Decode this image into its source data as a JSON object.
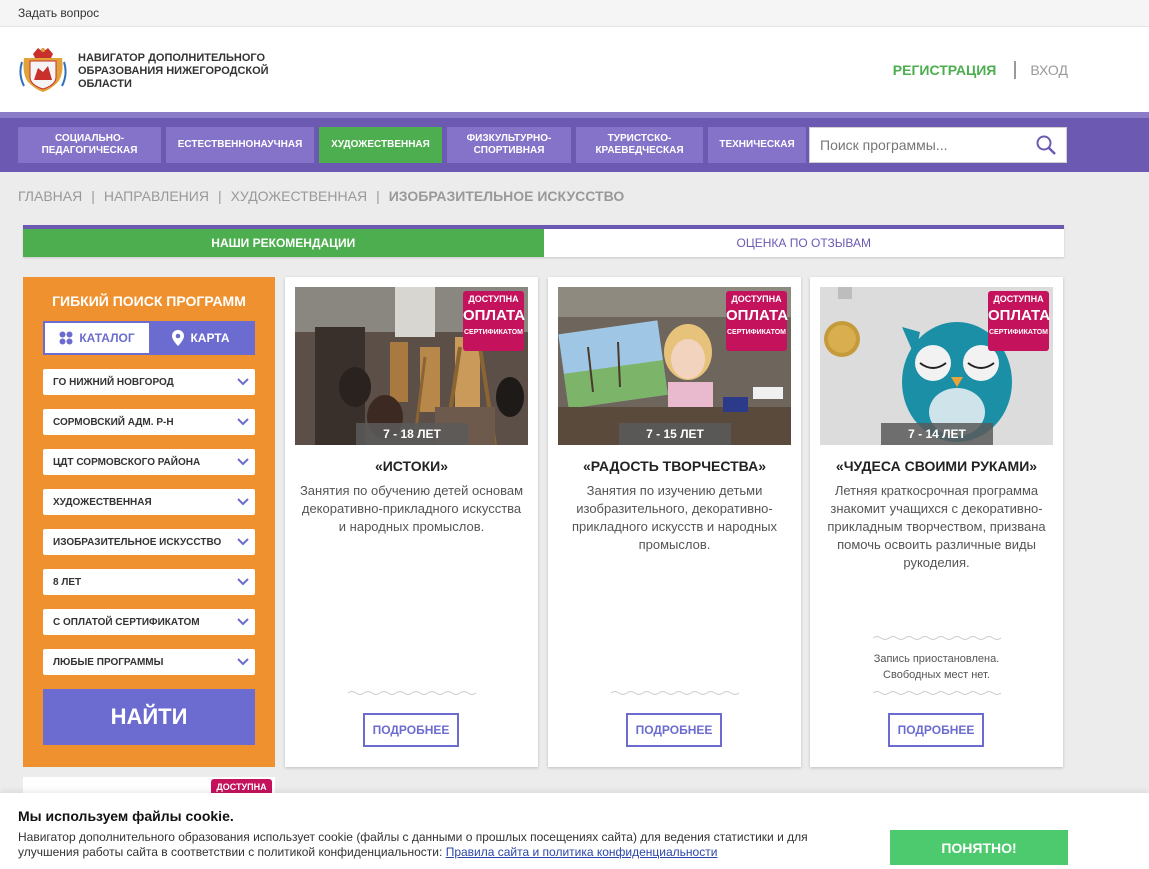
{
  "topbar": {
    "ask_link": "Задать вопрос"
  },
  "header": {
    "site_title": "НАВИГАТОР ДОПОЛНИТЕЛЬНОГО ОБРАЗОВАНИЯ НИЖЕГОРОДСКОЙ ОБЛАСТИ",
    "register": "РЕГИСТРАЦИЯ",
    "login": "ВХОД"
  },
  "nav": {
    "items": [
      {
        "label": "СОЦИАЛЬНО-ПЕДАГОГИЧЕСКАЯ",
        "active": false
      },
      {
        "label": "ЕСТЕСТВЕННОНАУЧНАЯ",
        "active": false
      },
      {
        "label": "ХУДОЖЕСТВЕННАЯ",
        "active": true
      },
      {
        "label": "ФИЗКУЛЬТУРНО-СПОРТИВНАЯ",
        "active": false
      },
      {
        "label": "ТУРИСТСКО-КРАЕВЕДЧЕСКАЯ",
        "active": false
      },
      {
        "label": "ТЕХНИЧЕСКАЯ",
        "active": false
      }
    ],
    "search_placeholder": "Поиск программы..."
  },
  "breadcrumb": {
    "items": [
      "ГЛАВНАЯ",
      "НАПРАВЛЕНИЯ",
      "ХУДОЖЕСТВЕННАЯ"
    ],
    "current": "ИЗОБРАЗИТЕЛЬНОЕ ИСКУССТВО"
  },
  "tabs": {
    "recommendations": "НАШИ РЕКОМЕНДАЦИИ",
    "reviews": "ОЦЕНКА ПО ОТЗЫВАМ"
  },
  "filter": {
    "title": "ГИБКИЙ ПОИСК ПРОГРАММ",
    "catalog": "КАТАЛОГ",
    "map": "КАРТА",
    "selects": [
      "ГО НИЖНИЙ НОВГОРОД",
      "СОРМОВСКИЙ АДМ. Р-Н",
      "ЦДТ СОРМОВСКОГО РАЙОНА",
      "ХУДОЖЕСТВЕННАЯ",
      "ИЗОБРАЗИТЕЛЬНОЕ ИСКУССТВО",
      "8 ЛЕТ",
      "С ОПЛАТОЙ СЕРТИФИКАТОМ",
      "ЛЮБЫЕ ПРОГРАММЫ"
    ],
    "find_button": "НАЙТИ"
  },
  "badge": {
    "line1": "ДОСТУПНА",
    "line2": "ОПЛАТА",
    "line3": "СЕРТИФИКАТОМ"
  },
  "cards": [
    {
      "age": "7 - 18 ЛЕТ",
      "title": "«ИСТОКИ»",
      "description": "Занятия по обучению детей основам декоративно-прикладного искусства и народных промыслов.",
      "status": "",
      "more": "ПОДРОБНЕЕ"
    },
    {
      "age": "7 - 15 ЛЕТ",
      "title": "«РАДОСТЬ ТВОРЧЕСТВА»",
      "description": "Занятия по изучению детьми изобразительного, декоративно-прикладного искусств и народных промыслов.",
      "status": "",
      "more": "ПОДРОБНЕЕ"
    },
    {
      "age": "7 - 14 ЛЕТ",
      "title": "«ЧУДЕСА СВОИМИ РУКАМИ»",
      "description": "Летняя краткосрочная программа знакомит учащихся с декоративно-прикладным творчеством, призвана помочь освоить различные виды рукоделия.",
      "status_line1": "Запись приостановлена.",
      "status_line2": "Свободных мест нет.",
      "more": "ПОДРОБНЕЕ"
    }
  ],
  "cookie": {
    "title": "Мы используем файлы cookie.",
    "text": "Навигатор дополнительного образования использует cookie (файлы с данными о прошлых посещениях сайта) для ведения статистики и для улучшения работы сайта в соответствии с политикой конфиденциальности: ",
    "link": "Правила сайта и политика конфиденциальности",
    "button": "ПОНЯТНО!"
  },
  "colors": {
    "purple": "#6c5ab2",
    "nav_button": "#8473c9",
    "green": "#4cae4f",
    "orange": "#f0912f",
    "indigo": "#6c6cd0",
    "badge": "#c4125d",
    "cookie_button": "#4dca6e"
  }
}
